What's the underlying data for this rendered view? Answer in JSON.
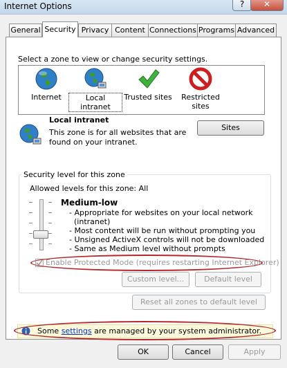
{
  "window": {
    "title": "Internet Options",
    "help": "?",
    "close": "✕"
  },
  "tabs": [
    {
      "label": "General"
    },
    {
      "label": "Security"
    },
    {
      "label": "Privacy"
    },
    {
      "label": "Content"
    },
    {
      "label": "Connections"
    },
    {
      "label": "Programs"
    },
    {
      "label": "Advanced"
    }
  ],
  "security": {
    "instruction": "Select a zone to view or change security settings.",
    "zones": [
      {
        "label": "Internet",
        "icon": "globe-icon"
      },
      {
        "label": "Local intranet",
        "icon": "intranet-globe-icon"
      },
      {
        "label": "Trusted sites",
        "icon": "checkmark-icon"
      },
      {
        "label": "Restricted sites",
        "icon": "no-entry-icon"
      }
    ],
    "selected_zone": {
      "name": "Local intranet",
      "desc1": "This zone is for all websites that are",
      "desc2": "found on your intranet.",
      "sites_button": "Sites"
    },
    "level": {
      "group_title": "Security level for this zone",
      "allowed": "Allowed levels for this zone: All",
      "name": "Medium-low",
      "bullets": [
        "- Appropriate for websites on your local network",
        "(intranet)",
        "- Most content will be run without prompting you",
        "- Unsigned ActiveX controls will not be downloaded",
        "- Same as Medium level without prompts"
      ],
      "protected_mode": "Enable Protected Mode (requires restarting Internet Explorer)",
      "custom_level": "Custom level...",
      "default_level": "Default level"
    },
    "reset_all": "Reset all zones to default level",
    "info": {
      "prefix": "Some ",
      "link": "settings",
      "suffix": " are managed by your system administrator."
    }
  },
  "buttons": {
    "ok": "OK",
    "cancel": "Cancel",
    "apply": "Apply"
  },
  "colors": {
    "annotation": "#b4262b",
    "link": "#0033cc",
    "disabled": "#9a9a9a"
  }
}
